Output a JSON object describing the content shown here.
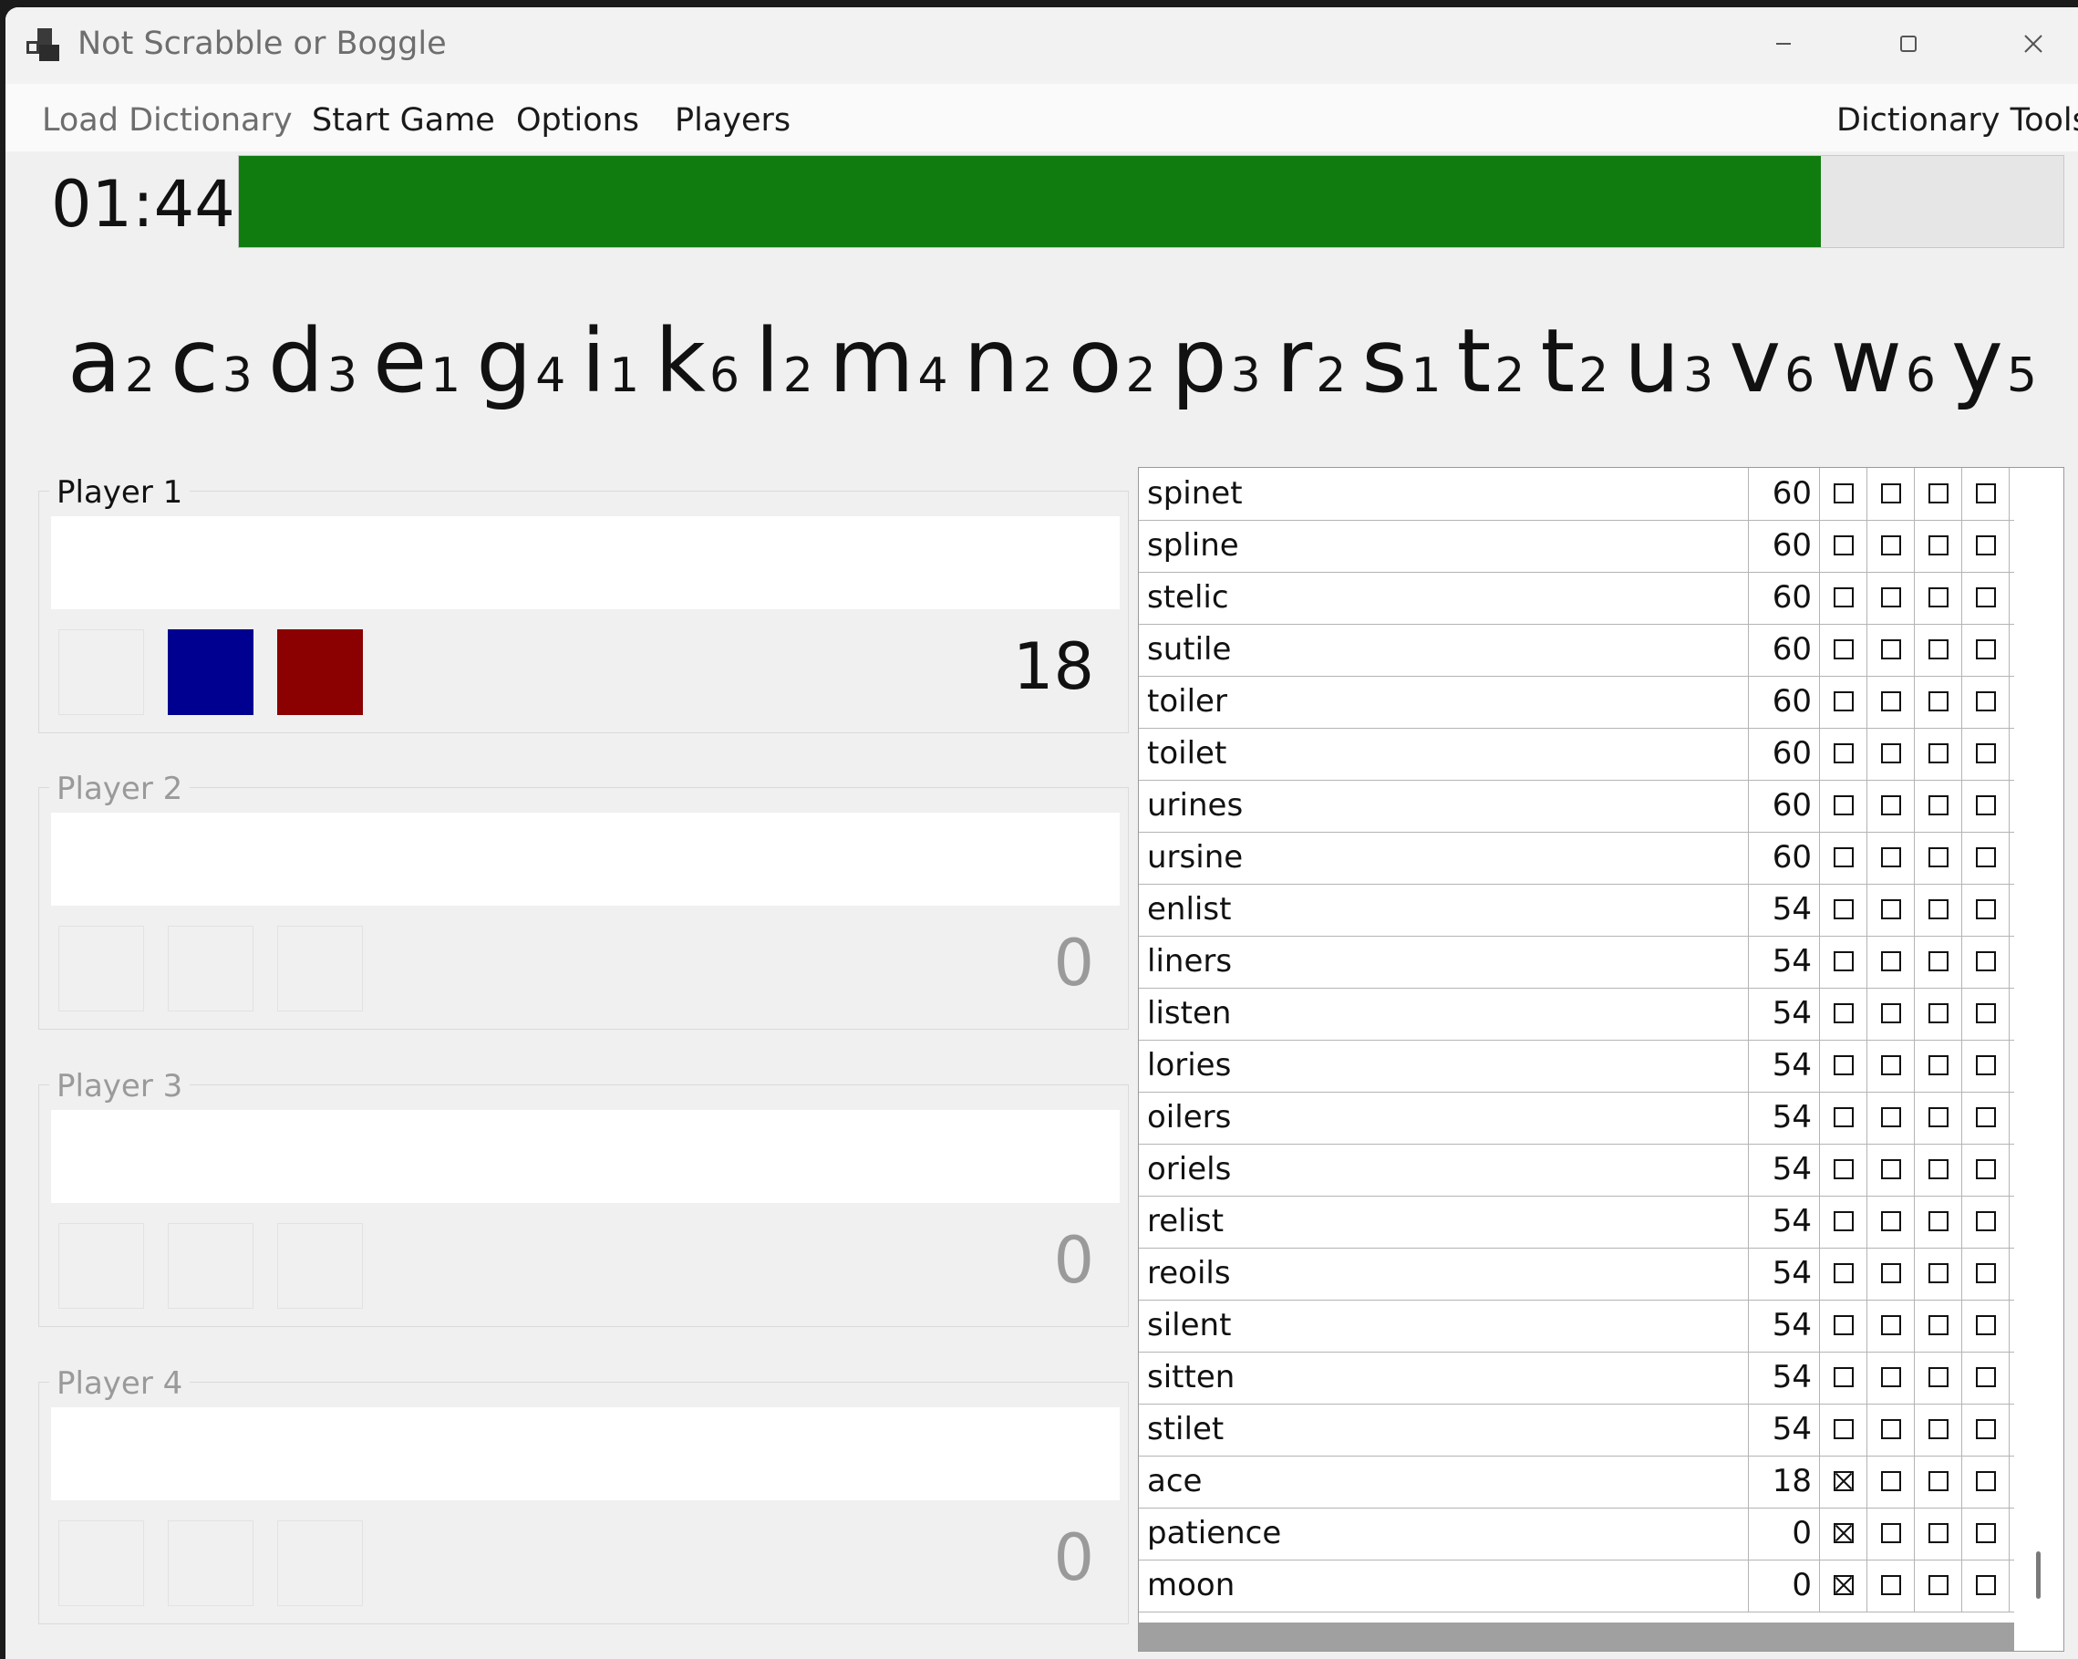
{
  "window": {
    "title": "Not Scrabble or Boggle",
    "controls": [
      "minimize",
      "maximize",
      "close"
    ]
  },
  "menu": {
    "load_dictionary": "Load Dictionary",
    "start_game": "Start Game",
    "options": "Options",
    "players": "Players",
    "dictionary_tools": "Dictionary Tools"
  },
  "timer": {
    "time": "01:44",
    "progress_fraction": 0.867,
    "color": "#107c10"
  },
  "letters": [
    {
      "ch": "a",
      "score": "2"
    },
    {
      "ch": "c",
      "score": "3"
    },
    {
      "ch": "d",
      "score": "3"
    },
    {
      "ch": "e",
      "score": "1"
    },
    {
      "ch": "g",
      "score": "4"
    },
    {
      "ch": "i",
      "score": "1"
    },
    {
      "ch": "k",
      "score": "6"
    },
    {
      "ch": "l",
      "score": "2"
    },
    {
      "ch": "m",
      "score": "4"
    },
    {
      "ch": "n",
      "score": "2"
    },
    {
      "ch": "o",
      "score": "2"
    },
    {
      "ch": "p",
      "score": "3"
    },
    {
      "ch": "r",
      "score": "2"
    },
    {
      "ch": "s",
      "score": "1"
    },
    {
      "ch": "t",
      "score": "2"
    },
    {
      "ch": "t",
      "score": "2"
    },
    {
      "ch": "u",
      "score": "3"
    },
    {
      "ch": "v",
      "score": "6"
    },
    {
      "ch": "w",
      "score": "6"
    },
    {
      "ch": "y",
      "score": "5"
    }
  ],
  "players": [
    {
      "label": "Player 1",
      "entry": "",
      "score": "18",
      "active": true,
      "slots": [
        "",
        "#000090",
        "#8b0000"
      ]
    },
    {
      "label": "Player 2",
      "entry": "",
      "score": "0",
      "active": false,
      "slots": [
        "",
        "",
        ""
      ]
    },
    {
      "label": "Player 3",
      "entry": "",
      "score": "0",
      "active": false,
      "slots": [
        "",
        "",
        ""
      ]
    },
    {
      "label": "Player 4",
      "entry": "",
      "score": "0",
      "active": false,
      "slots": [
        "",
        "",
        ""
      ]
    }
  ],
  "words": [
    {
      "word": "spinet",
      "points": "60",
      "checks": [
        false,
        false,
        false,
        false
      ]
    },
    {
      "word": "spline",
      "points": "60",
      "checks": [
        false,
        false,
        false,
        false
      ]
    },
    {
      "word": "stelic",
      "points": "60",
      "checks": [
        false,
        false,
        false,
        false
      ]
    },
    {
      "word": "sutile",
      "points": "60",
      "checks": [
        false,
        false,
        false,
        false
      ]
    },
    {
      "word": "toiler",
      "points": "60",
      "checks": [
        false,
        false,
        false,
        false
      ]
    },
    {
      "word": "toilet",
      "points": "60",
      "checks": [
        false,
        false,
        false,
        false
      ]
    },
    {
      "word": "urines",
      "points": "60",
      "checks": [
        false,
        false,
        false,
        false
      ]
    },
    {
      "word": "ursine",
      "points": "60",
      "checks": [
        false,
        false,
        false,
        false
      ]
    },
    {
      "word": "enlist",
      "points": "54",
      "checks": [
        false,
        false,
        false,
        false
      ]
    },
    {
      "word": "liners",
      "points": "54",
      "checks": [
        false,
        false,
        false,
        false
      ]
    },
    {
      "word": "listen",
      "points": "54",
      "checks": [
        false,
        false,
        false,
        false
      ]
    },
    {
      "word": "lories",
      "points": "54",
      "checks": [
        false,
        false,
        false,
        false
      ]
    },
    {
      "word": "oilers",
      "points": "54",
      "checks": [
        false,
        false,
        false,
        false
      ]
    },
    {
      "word": "oriels",
      "points": "54",
      "checks": [
        false,
        false,
        false,
        false
      ]
    },
    {
      "word": "relist",
      "points": "54",
      "checks": [
        false,
        false,
        false,
        false
      ]
    },
    {
      "word": "reoils",
      "points": "54",
      "checks": [
        false,
        false,
        false,
        false
      ]
    },
    {
      "word": "silent",
      "points": "54",
      "checks": [
        false,
        false,
        false,
        false
      ]
    },
    {
      "word": "sitten",
      "points": "54",
      "checks": [
        false,
        false,
        false,
        false
      ]
    },
    {
      "word": "stilet",
      "points": "54",
      "checks": [
        false,
        false,
        false,
        false
      ]
    },
    {
      "word": "ace",
      "points": "18",
      "checks": [
        true,
        false,
        false,
        false
      ]
    },
    {
      "word": "patience",
      "points": "0",
      "checks": [
        true,
        false,
        false,
        false
      ]
    },
    {
      "word": "moon",
      "points": "0",
      "checks": [
        true,
        false,
        false,
        false
      ]
    }
  ]
}
